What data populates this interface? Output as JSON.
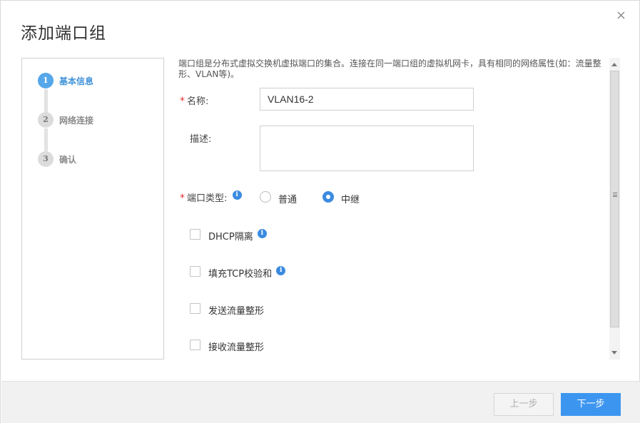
{
  "dialog": {
    "title": "添加端口组",
    "close_glyph": "×"
  },
  "steps": [
    {
      "number": "1",
      "label": "基本信息",
      "state": "active"
    },
    {
      "number": "2",
      "label": "网络连接",
      "state": "inactive"
    },
    {
      "number": "3",
      "label": "确认",
      "state": "inactive"
    }
  ],
  "form": {
    "description": "端口组是分布式虚拟交换机虚拟端口的集合。连接在同一端口组的虚拟机网卡，具有相同的网络属性(如：流量整形、VLAN等)。",
    "required_mark": "*",
    "name_label": "名称:",
    "name_value": "VLAN16-2",
    "desc_label": "描述:",
    "desc_value": "",
    "port_type_label": "端口类型:",
    "info_glyph": "i",
    "port_type_options": [
      {
        "label": "普通",
        "checked": false
      },
      {
        "label": "中继",
        "checked": true
      }
    ],
    "checkboxes": [
      {
        "label": "DHCP隔离",
        "checked": false,
        "has_info": true
      },
      {
        "label": "填充TCP校验和",
        "checked": false,
        "has_info": true
      },
      {
        "label": "发送流量整形",
        "checked": false,
        "has_info": false
      },
      {
        "label": "接收流量整形",
        "checked": false,
        "has_info": false
      }
    ]
  },
  "footer": {
    "prev_label": "上一步",
    "next_label": "下一步"
  },
  "colors": {
    "accent": "#3c96f0",
    "step_active": "#56a7ea",
    "required": "#ee3333",
    "info": "#3b8be0"
  },
  "icons": {
    "close": "close-icon",
    "info": "info-icon",
    "scroll_up": "chevron-up-icon",
    "scroll_down": "chevron-down-icon"
  }
}
